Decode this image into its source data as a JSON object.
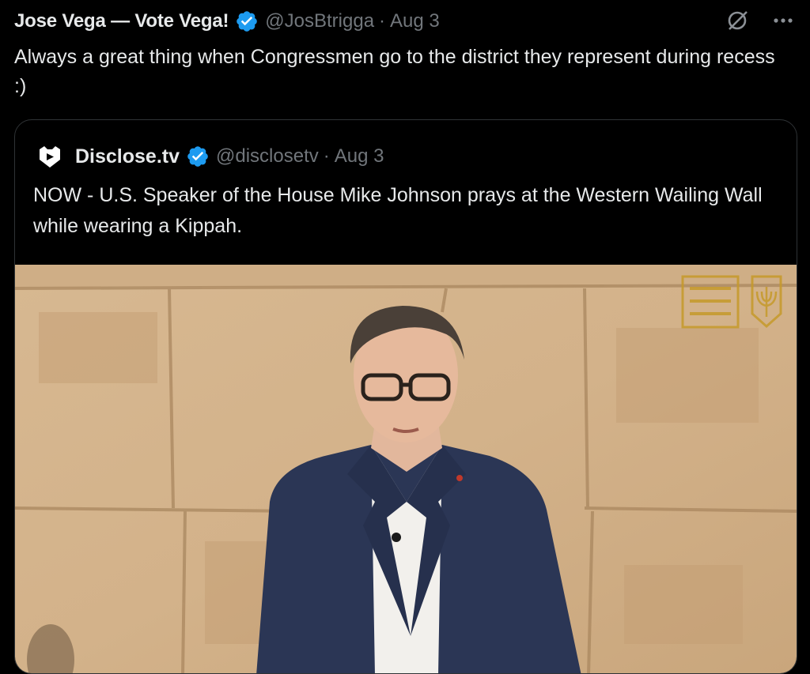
{
  "tweet": {
    "author_name": "Jose Vega — Vote Vega!",
    "handle": "@JosBtrigga",
    "separator": "·",
    "date": "Aug 3",
    "text": "Always a great thing when Congressmen go to the district they represent during recess :)",
    "icons": {
      "verified": "verified-badge-icon",
      "grok": "grok-icon",
      "more": "more-icon"
    }
  },
  "quoted": {
    "author_name": "Disclose.tv",
    "handle": "@disclosetv",
    "separator": "·",
    "date": "Aug 3",
    "text": "NOW - U.S. Speaker of the House Mike Johnson prays at the Western Wailing Wall while wearing a Kippah.",
    "icons": {
      "avatar": "disclose-logo-icon",
      "verified": "verified-badge-icon"
    },
    "media": {
      "type": "video-still",
      "emblem": "israel-emblem-icon"
    }
  },
  "colors": {
    "background": "#000000",
    "text": "#e7e9ea",
    "secondary": "#71767b",
    "verified": "#1d9bf0",
    "border": "#2f3336"
  }
}
